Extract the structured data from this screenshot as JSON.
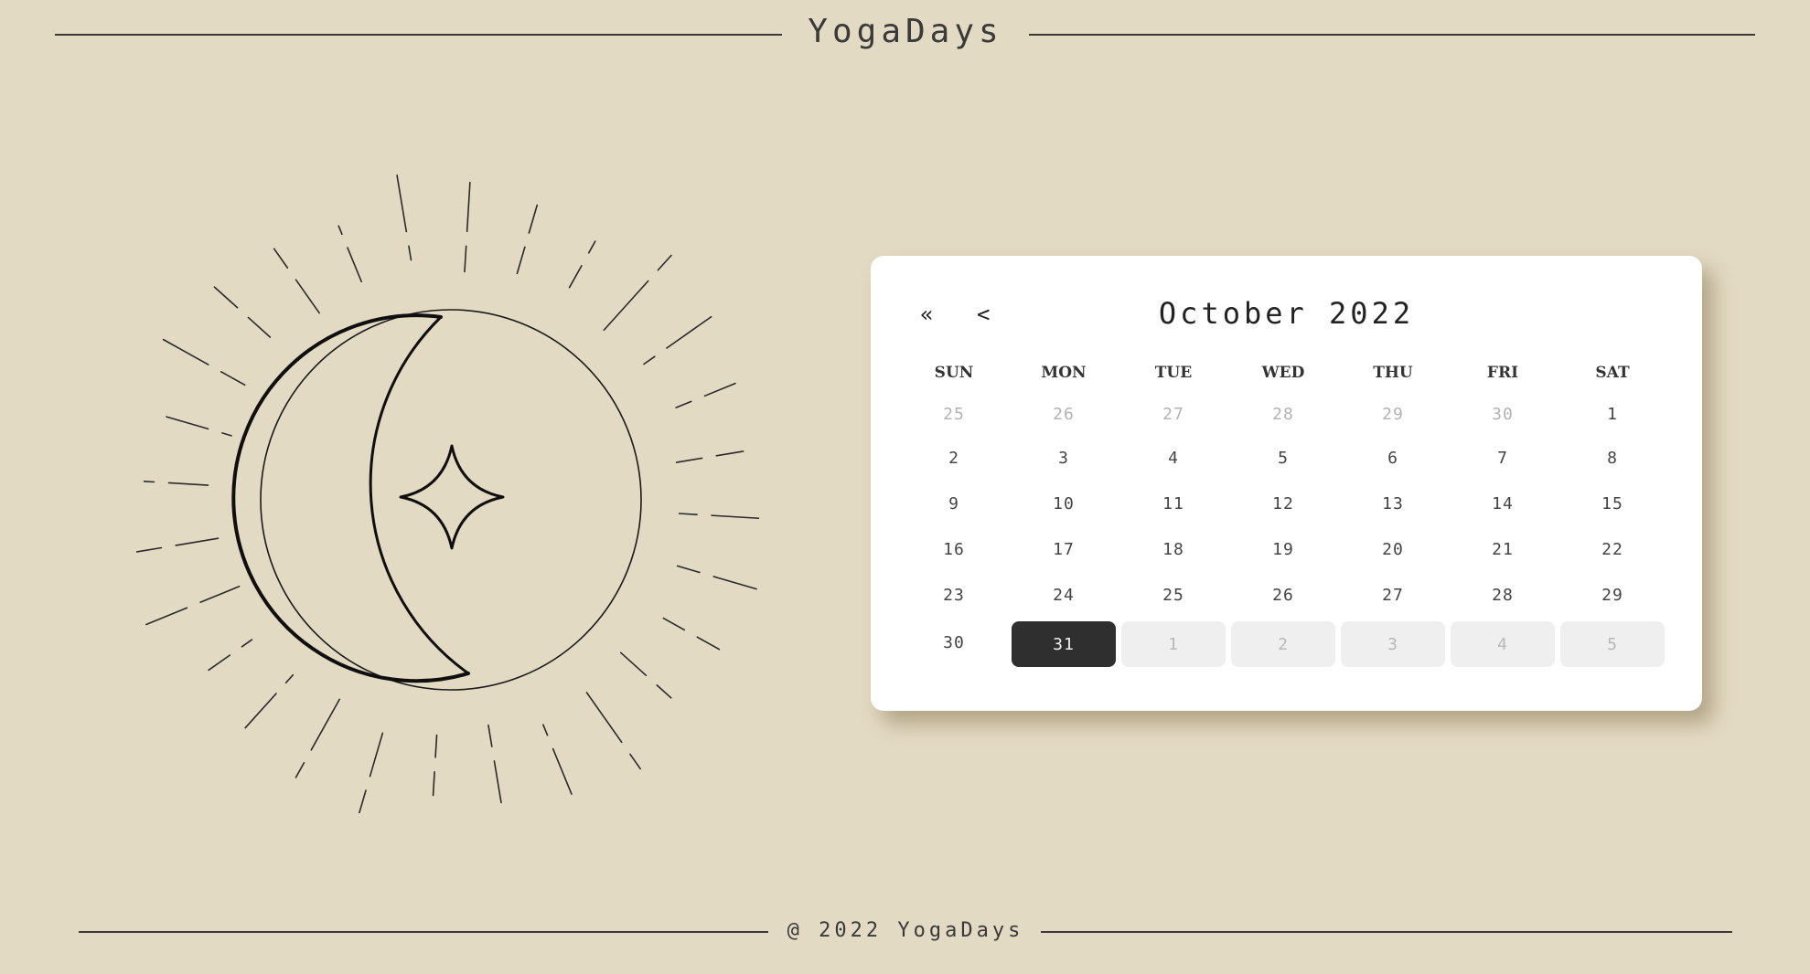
{
  "header": {
    "title": "YogaDays"
  },
  "calendar": {
    "nav": {
      "prev_year": "«",
      "prev_month": "<"
    },
    "month_label": "October 2022",
    "weekdays": [
      "SUN",
      "MON",
      "TUE",
      "WED",
      "THU",
      "FRI",
      "SAT"
    ],
    "days": [
      {
        "label": "25",
        "state": "muted"
      },
      {
        "label": "26",
        "state": "muted"
      },
      {
        "label": "27",
        "state": "muted"
      },
      {
        "label": "28",
        "state": "muted"
      },
      {
        "label": "29",
        "state": "muted"
      },
      {
        "label": "30",
        "state": "muted"
      },
      {
        "label": "1",
        "state": "normal"
      },
      {
        "label": "2",
        "state": "normal"
      },
      {
        "label": "3",
        "state": "normal"
      },
      {
        "label": "4",
        "state": "normal"
      },
      {
        "label": "5",
        "state": "normal"
      },
      {
        "label": "6",
        "state": "normal"
      },
      {
        "label": "7",
        "state": "normal"
      },
      {
        "label": "8",
        "state": "normal"
      },
      {
        "label": "9",
        "state": "normal"
      },
      {
        "label": "10",
        "state": "normal"
      },
      {
        "label": "11",
        "state": "normal"
      },
      {
        "label": "12",
        "state": "normal"
      },
      {
        "label": "13",
        "state": "normal"
      },
      {
        "label": "14",
        "state": "normal"
      },
      {
        "label": "15",
        "state": "normal"
      },
      {
        "label": "16",
        "state": "normal"
      },
      {
        "label": "17",
        "state": "normal"
      },
      {
        "label": "18",
        "state": "normal"
      },
      {
        "label": "19",
        "state": "normal"
      },
      {
        "label": "20",
        "state": "normal"
      },
      {
        "label": "21",
        "state": "normal"
      },
      {
        "label": "22",
        "state": "normal"
      },
      {
        "label": "23",
        "state": "normal"
      },
      {
        "label": "24",
        "state": "normal"
      },
      {
        "label": "25",
        "state": "normal"
      },
      {
        "label": "26",
        "state": "normal"
      },
      {
        "label": "27",
        "state": "normal"
      },
      {
        "label": "28",
        "state": "normal"
      },
      {
        "label": "29",
        "state": "normal"
      },
      {
        "label": "30",
        "state": "normal"
      },
      {
        "label": "31",
        "state": "selected"
      },
      {
        "label": "1",
        "state": "next"
      },
      {
        "label": "2",
        "state": "next"
      },
      {
        "label": "3",
        "state": "next"
      },
      {
        "label": "4",
        "state": "next"
      },
      {
        "label": "5",
        "state": "next"
      }
    ]
  },
  "illustration": {
    "icons": [
      "sun-rays-icon",
      "crescent-moon-icon",
      "sparkle-star-icon"
    ]
  },
  "footer": {
    "text": "@ 2022 YogaDays"
  },
  "colors": {
    "background": "#e3dac3",
    "card": "#ffffff",
    "selected": "#2f2f2f",
    "next_month": "#efefef",
    "ink": "#2a2a2a"
  }
}
